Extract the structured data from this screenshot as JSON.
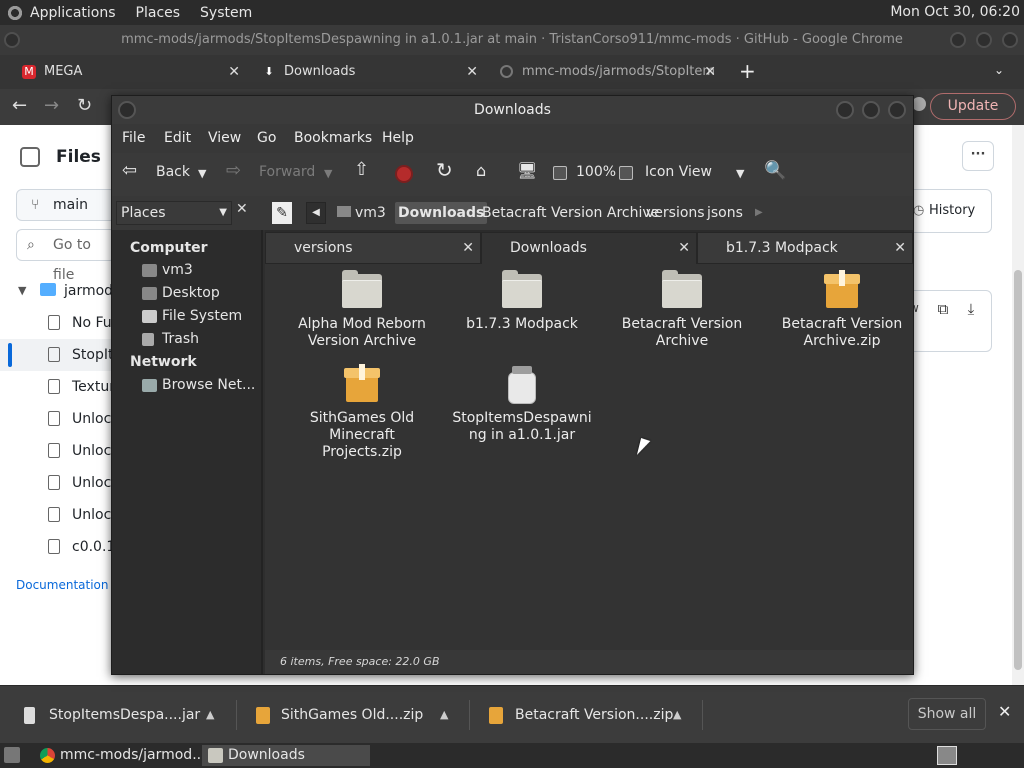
{
  "top_panel": {
    "menus": [
      "Applications",
      "Places",
      "System"
    ],
    "clock": "Mon Oct 30, 06:20"
  },
  "chrome": {
    "title": "mmc-mods/jarmods/StopItemsDespawning in a1.0.1.jar at main · TristanCorso911/mmc-mods · GitHub - Google Chrome",
    "tabs": [
      {
        "label": "MEGA",
        "icon": "mega-icon"
      },
      {
        "label": "Downloads",
        "icon": "download-icon"
      },
      {
        "label": "mmc-mods/jarmods/StopItem",
        "icon": "github-icon"
      }
    ],
    "update_label": "Update"
  },
  "github": {
    "files_title": "Files",
    "branch": "main",
    "goto_placeholder": "Go to file",
    "history": "History",
    "raw_label": "w",
    "more": "···",
    "tree": [
      {
        "name": "jarmods",
        "type": "folder"
      },
      {
        "name": "No Fu",
        "type": "file"
      },
      {
        "name": "StopIte",
        "type": "file",
        "selected": true
      },
      {
        "name": "Textur",
        "type": "file"
      },
      {
        "name": "Unlock",
        "type": "file"
      },
      {
        "name": "Unlock",
        "type": "file"
      },
      {
        "name": "Unlock",
        "type": "file"
      },
      {
        "name": "Unlock",
        "type": "file"
      },
      {
        "name": "c0.0.1",
        "type": "file"
      }
    ],
    "footer": "Documentation • S"
  },
  "downloads_bar": {
    "items": [
      "StopItemsDespa....jar",
      "SithGames Old....zip",
      "Betacraft Version....zip"
    ],
    "show_all": "Show all"
  },
  "taskbar": {
    "tasks": [
      "mmc-mods/jarmod...",
      "Downloads"
    ]
  },
  "file_manager": {
    "title": "Downloads",
    "menus": [
      "File",
      "Edit",
      "View",
      "Go",
      "Bookmarks",
      "Help"
    ],
    "toolbar": {
      "back": "Back",
      "forward": "Forward",
      "zoom": "100%",
      "view_mode": "Icon View"
    },
    "places_label": "Places",
    "path": [
      "vm3",
      "Downloads",
      "Betacraft Version Archive",
      "versions",
      "jsons"
    ],
    "active_crumb": "Downloads",
    "sidebar": {
      "computer_header": "Computer",
      "computer_items": [
        "vm3",
        "Desktop",
        "File System",
        "Trash"
      ],
      "network_header": "Network",
      "network_items": [
        "Browse Net..."
      ]
    },
    "tabs": [
      "versions",
      "Downloads",
      "b1.7.3 Modpack"
    ],
    "active_tab": "Downloads",
    "items": [
      {
        "name": "Alpha Mod Reborn Version Archive",
        "kind": "folder"
      },
      {
        "name": "b1.7.3 Modpack",
        "kind": "folder"
      },
      {
        "name": "Betacraft Version Archive",
        "kind": "folder"
      },
      {
        "name": "Betacraft Version Archive.zip",
        "kind": "zip"
      },
      {
        "name": "SithGames Old Minecraft Projects.zip",
        "kind": "zip"
      },
      {
        "name": "StopItemsDespawning in a1.0.1.jar",
        "kind": "jar"
      }
    ],
    "status": "6 items, Free space: 22.0 GB"
  }
}
